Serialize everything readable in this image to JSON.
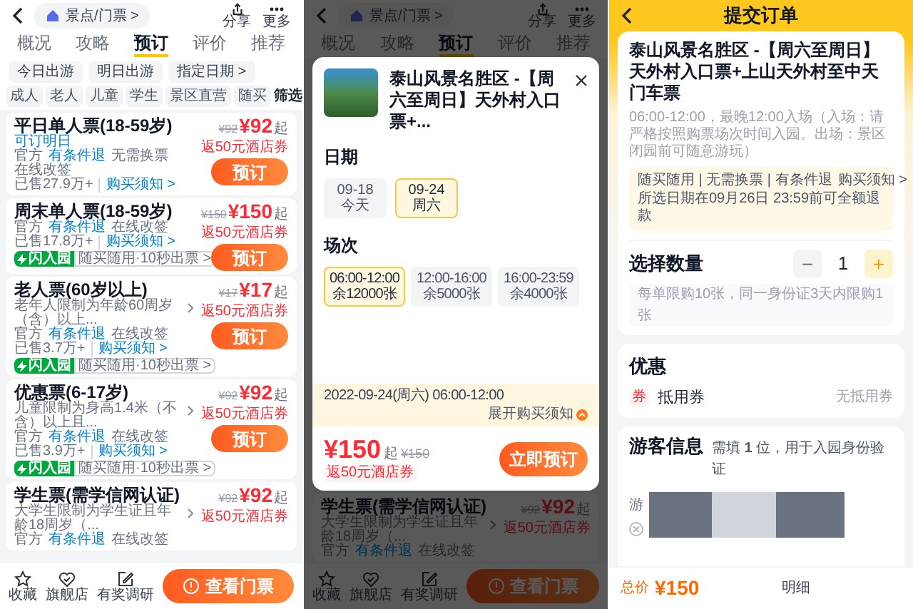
{
  "ticket_list_screen": {
    "header": {
      "breadcrumb": "景点/门票 >",
      "share_label": "分享",
      "more_label": "更多"
    },
    "tabs": [
      {
        "label": "概况",
        "selected": false
      },
      {
        "label": "攻略",
        "selected": false
      },
      {
        "label": "预订",
        "selected": true
      },
      {
        "label": "评价",
        "selected": false
      },
      {
        "label": "推荐",
        "selected": false
      }
    ],
    "date_chips": [
      "今日出游",
      "明日出游",
      "指定日期 >"
    ],
    "filter_chips": [
      "成人",
      "老人",
      "儿童",
      "学生",
      "景区直营",
      "随买"
    ],
    "filter_button": "筛选",
    "tickets": [
      {
        "name": "平日单人票(18-59岁)",
        "note": "可订明日",
        "tags": [
          {
            "text": "官方",
            "highlight": false
          },
          {
            "text": "有条件退",
            "highlight": true
          },
          {
            "text": "无需换票",
            "highlight": false
          },
          {
            "text": "在线改签",
            "highlight": false
          }
        ],
        "sold": "已售27.9万+",
        "notice_link": "购买须知 >",
        "original_price": "¥92",
        "price": "¥92",
        "price_suffix": "起",
        "coupon": "返50元酒店券",
        "button": "预订"
      },
      {
        "name": "周末单人票(18-59岁)",
        "tags": [
          {
            "text": "官方",
            "highlight": false
          },
          {
            "text": "有条件退",
            "highlight": true
          },
          {
            "text": "在线改签",
            "highlight": false
          }
        ],
        "sold": "已售17.8万+",
        "notice_link": "购买须知 >",
        "badge": {
          "label": "闪入园",
          "text": "随买随用·10秒出票 >"
        },
        "original_price": "¥150",
        "price": "¥150",
        "price_suffix": "起",
        "coupon": "返50元酒店券",
        "button": "预订"
      },
      {
        "name": "老人票(60岁以上)",
        "desc": "老年人限制为年龄60周岁（含）以上...",
        "tags": [
          {
            "text": "官方",
            "highlight": false
          },
          {
            "text": "有条件退",
            "highlight": true
          },
          {
            "text": "在线改签",
            "highlight": false
          }
        ],
        "sold": "已售3.7万+",
        "notice_link": "购买须知 >",
        "badge": {
          "label": "闪入园",
          "text": "随买随用·10秒出票 >"
        },
        "original_price": "¥17",
        "price": "¥17",
        "price_suffix": "起",
        "coupon": "返50元酒店券",
        "button": "预订"
      },
      {
        "name": "优惠票(6-17岁)",
        "desc": "儿童限制为身高1.4米（不含）以上且...",
        "tags": [
          {
            "text": "官方",
            "highlight": false
          },
          {
            "text": "有条件退",
            "highlight": true
          },
          {
            "text": "在线改签",
            "highlight": false
          }
        ],
        "sold": "已售3.9万+",
        "notice_link": "购买须知 >",
        "badge": {
          "label": "闪入园",
          "text": "随买随用·10秒出票 >"
        },
        "original_price": "¥92",
        "price": "¥92",
        "price_suffix": "起",
        "coupon": "返50元酒店券",
        "button": "预订"
      },
      {
        "name": "学生票(需学信网认证)",
        "desc": "大学生限制为学生证且年龄18周岁（...",
        "tags": [
          {
            "text": "官方",
            "highlight": false
          },
          {
            "text": "有条件退",
            "highlight": true
          },
          {
            "text": "在线改签",
            "highlight": false
          }
        ],
        "original_price": "¥92",
        "price": "¥92",
        "price_suffix": "起",
        "coupon": "返50元酒店券"
      }
    ],
    "bottom_bar": {
      "items": [
        {
          "kind": "star",
          "label": "收藏"
        },
        {
          "kind": "shop",
          "label": "旗舰店"
        },
        {
          "kind": "survey",
          "label": "有奖调研"
        }
      ],
      "primary_button": "查看门票"
    }
  },
  "booking_sheet_screen": {
    "background": {
      "header": {
        "breadcrumb": "景点/门票 >",
        "share_label": "分享",
        "more_label": "更多"
      },
      "tabs": [
        {
          "label": "概况",
          "selected": false
        },
        {
          "label": "攻略",
          "selected": false
        },
        {
          "label": "预订",
          "selected": true
        },
        {
          "label": "评价",
          "selected": false
        },
        {
          "label": "推荐",
          "selected": false
        }
      ],
      "visible_ticket": {
        "name": "学生票(需学信网认证)",
        "desc": "大学生限制为学生证且年龄18周岁（...",
        "tags": [
          {
            "text": "官方",
            "highlight": false
          },
          {
            "text": "有条件退",
            "highlight": true
          },
          {
            "text": "在线改签",
            "highlight": false
          }
        ],
        "original_price": "¥92",
        "price": "¥92",
        "price_suffix": "起",
        "coupon": "返50元酒店券"
      },
      "bottom_bar": {
        "items": [
          {
            "kind": "star",
            "label": "收藏"
          },
          {
            "kind": "shop",
            "label": "旗舰店"
          },
          {
            "kind": "survey",
            "label": "有奖调研"
          }
        ],
        "primary_button": "查看门票"
      }
    },
    "sheet": {
      "title": "泰山风景名胜区 -【周六至周日】天外村入口票+...",
      "date_label": "日期",
      "dates": [
        {
          "date": "09-18",
          "note": "今天",
          "selected": false
        },
        {
          "date": "09-24",
          "note": "周六",
          "selected": true
        }
      ],
      "session_label": "场次",
      "sessions": [
        {
          "time": "06:00-12:00",
          "remaining": "余12000张",
          "selected": true
        },
        {
          "time": "12:00-16:00",
          "remaining": "余5000张",
          "selected": false
        },
        {
          "time": "16:00-23:59",
          "remaining": "余4000张",
          "selected": false
        }
      ],
      "summary": "2022-09-24(周六) 06:00-12:00",
      "notice_toggle": "展开购买须知",
      "price": "¥150",
      "price_suffix": "起",
      "original_price": "¥150",
      "coupon": "返50元酒店券",
      "book_button": "立即预订"
    }
  },
  "order_screen": {
    "title": "提交订单",
    "product": {
      "title": "泰山风景名胜区 -【周六至周日】天外村入口票+上山天外村至中天门车票",
      "desc": "06:00-12:00，最晚12:00入场（入场：请严格按照购票场次时间入园。出场：景区闭园前可随意游玩）",
      "perks": "随买随用 | 无需换票 | 有条件退",
      "notice_link": "购买须知 >",
      "refund_note": "所选日期在09月26日 23:59前可全额退款"
    },
    "quantity": {
      "label": "选择数量",
      "minus": "−",
      "decrement_disabled": true,
      "value": "1",
      "plus": "+",
      "limit_note": "每单限购10张，同一身份证3天内限购1张"
    },
    "discount": {
      "title": "优惠",
      "badge": "券",
      "label": "抵用券",
      "value": "无抵用券"
    },
    "visitors": {
      "title": "游客信息",
      "hint": "需填 **1** 位，用于入园身份验证",
      "field_label": "游"
    },
    "footer": {
      "total_label": "总价",
      "total": "¥150",
      "details": "明细"
    }
  }
}
